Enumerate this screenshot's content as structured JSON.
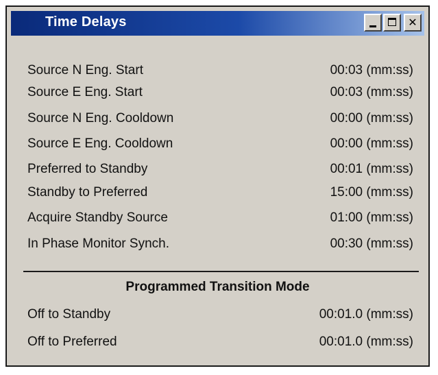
{
  "window": {
    "title": "Time Delays",
    "controls": {
      "minimize": "minimize-icon",
      "maximize": "maximize-icon",
      "close_glyph": "✕"
    }
  },
  "delays": [
    {
      "label": "Source N Eng. Start",
      "value": "00:03 (mm:ss)"
    },
    {
      "label": "Source E Eng. Start",
      "value": "00:03 (mm:ss)"
    },
    {
      "label": "Source N Eng. Cooldown",
      "value": "00:00 (mm:ss)"
    },
    {
      "label": "Source E Eng. Cooldown",
      "value": "00:00 (mm:ss)"
    },
    {
      "label": "Preferred to Standby",
      "value": "00:01 (mm:ss)"
    },
    {
      "label": "Standby to Preferred",
      "value": "15:00 (mm:ss)"
    },
    {
      "label": "Acquire Standby Source",
      "value": "01:00 (mm:ss)"
    },
    {
      "label": "In Phase Monitor Synch.",
      "value": "00:30 (mm:ss)"
    }
  ],
  "transition": {
    "title": "Programmed Transition Mode",
    "rows": [
      {
        "label": "Off to Standby",
        "value": "00:01.0 (mm:ss)"
      },
      {
        "label": "Off to Preferred",
        "value": "00:01.0 (mm:ss)"
      }
    ]
  },
  "colors": {
    "titlebar_start": "#0a2a7a",
    "titlebar_end": "#a6c2ea",
    "panel": "#d4d0c8"
  }
}
